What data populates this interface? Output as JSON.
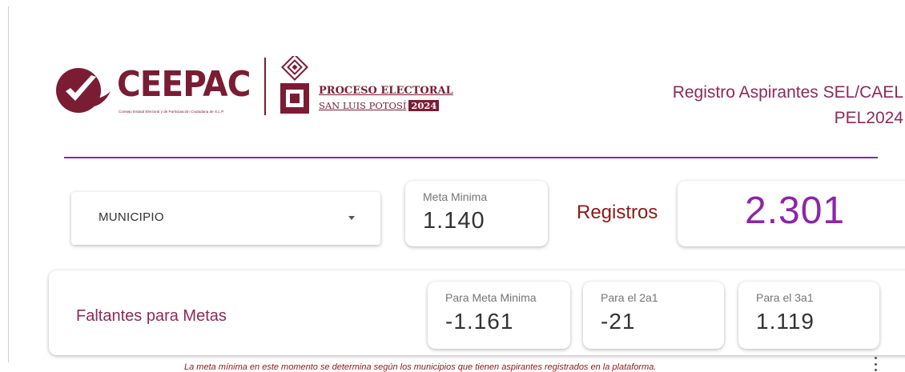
{
  "logo": {
    "brand": "CEEPAC",
    "brand_sub": "Consejo Estatal Electoral y de Participación Ciudadana de S.L.P.",
    "process_title": "PROCESO ELECTORAL",
    "process_place": "SAN LUIS POTOSÍ",
    "process_year": "2024"
  },
  "header": {
    "title_line1": "Registro Aspirantes SEL/CAEL",
    "title_line2": "PEL2024"
  },
  "filter": {
    "selected": "MUNICIPIO"
  },
  "meta_minima": {
    "label": "Meta Minima",
    "value": "1.140"
  },
  "registros": {
    "label": "Registros",
    "value": "2.301"
  },
  "faltantes": {
    "label": "Faltantes para Metas",
    "items": [
      {
        "label": "Para Meta Minima",
        "value": "-1.161"
      },
      {
        "label": "Para el 2a1",
        "value": "-21"
      },
      {
        "label": "Para el 3a1",
        "value": "1.119"
      }
    ]
  },
  "note": "La meta mínima en este momento se determina según los municipios que tienen aspirantes registrados en la plataforma.",
  "colors": {
    "brand": "#7b1c35",
    "accent_purple": "#8e24aa",
    "title": "#8b2a5a",
    "label_red": "#8b1a1a"
  }
}
